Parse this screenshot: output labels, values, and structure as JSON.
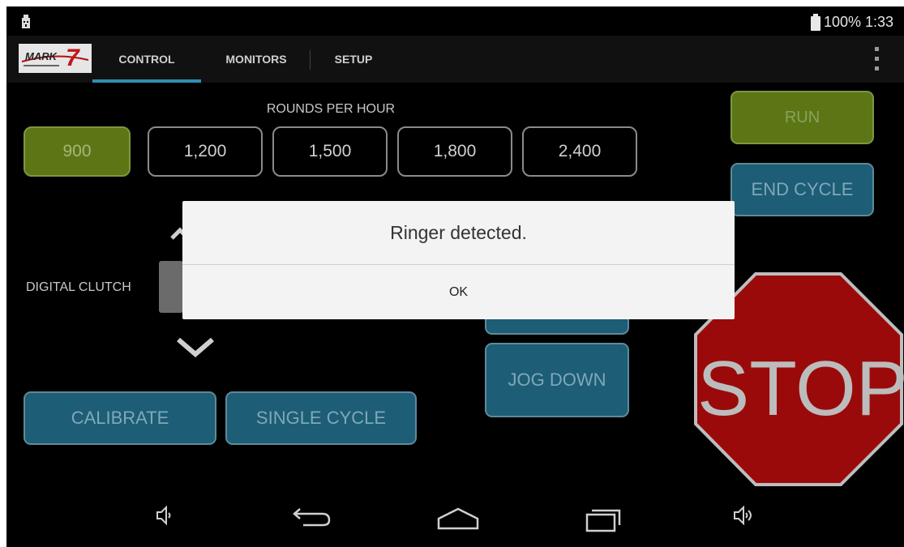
{
  "status_bar": {
    "battery": "100%",
    "time": "1:33",
    "text": "100% 1:33",
    "icons": [
      "usb-icon",
      "battery-icon"
    ]
  },
  "action_bar": {
    "logo_text": "MARK 7",
    "tabs": [
      {
        "label": "CONTROL",
        "selected": true
      },
      {
        "label": "MONITORS",
        "selected": false
      },
      {
        "label": "SETUP",
        "selected": false
      }
    ],
    "overflow_icon": "overflow-menu-icon"
  },
  "control": {
    "rph_label": "ROUNDS PER HOUR",
    "rates": [
      {
        "label": "900",
        "selected": true
      },
      {
        "label": "1,200",
        "selected": false
      },
      {
        "label": "1,500",
        "selected": false
      },
      {
        "label": "1,800",
        "selected": false
      },
      {
        "label": "2,400",
        "selected": false
      }
    ],
    "run_label": "RUN",
    "end_cycle_label": "END CYCLE",
    "digital_clutch_label": "DIGITAL CLUTCH",
    "jog_down_label": "JOG DOWN",
    "calibrate_label": "CALIBRATE",
    "single_cycle_label": "SINGLE CYCLE",
    "stop_label": "STOP"
  },
  "dialog": {
    "message": "Ringer detected.",
    "ok_label": "OK"
  },
  "nav_bar": {
    "icons": [
      "volume-down-icon",
      "back-icon",
      "home-icon",
      "recent-apps-icon",
      "volume-up-icon"
    ]
  },
  "colors": {
    "selected_green": "#5c7616",
    "button_blue": "#1d5d76",
    "tab_indicator": "#2f8fb3",
    "stop_red": "#9b0a0a"
  }
}
